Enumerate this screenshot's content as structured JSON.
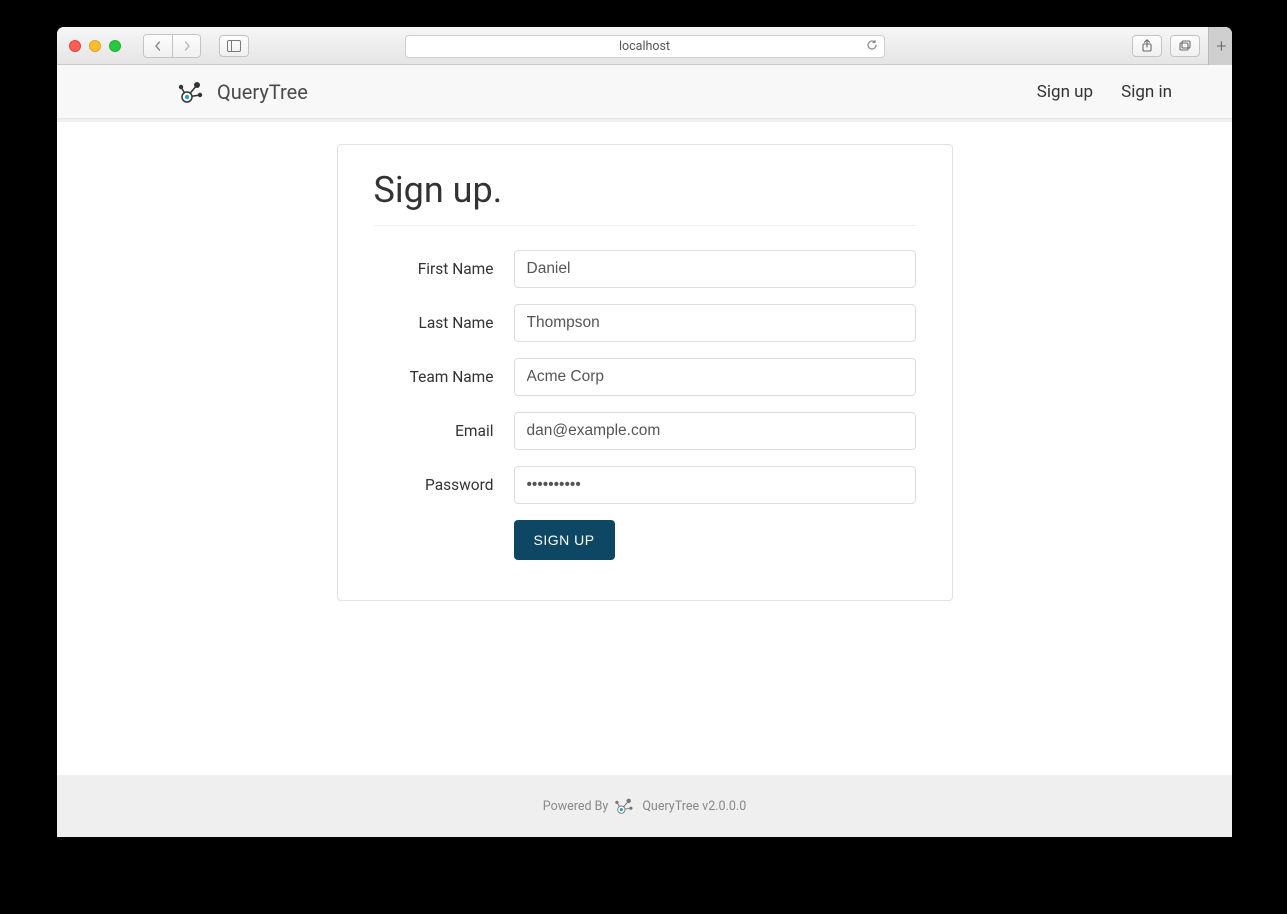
{
  "browser": {
    "url": "localhost"
  },
  "header": {
    "brand": "QueryTree",
    "nav": {
      "signup": "Sign up",
      "signin": "Sign in"
    }
  },
  "form": {
    "title": "Sign up.",
    "labels": {
      "first_name": "First Name",
      "last_name": "Last Name",
      "team_name": "Team Name",
      "email": "Email",
      "password": "Password"
    },
    "values": {
      "first_name": "Daniel",
      "last_name": "Thompson",
      "team_name": "Acme Corp",
      "email": "dan@example.com",
      "password": "••••••••••"
    },
    "submit": "SIGN UP"
  },
  "footer": {
    "powered_by": "Powered By",
    "product": "QueryTree v2.0.0.0"
  }
}
